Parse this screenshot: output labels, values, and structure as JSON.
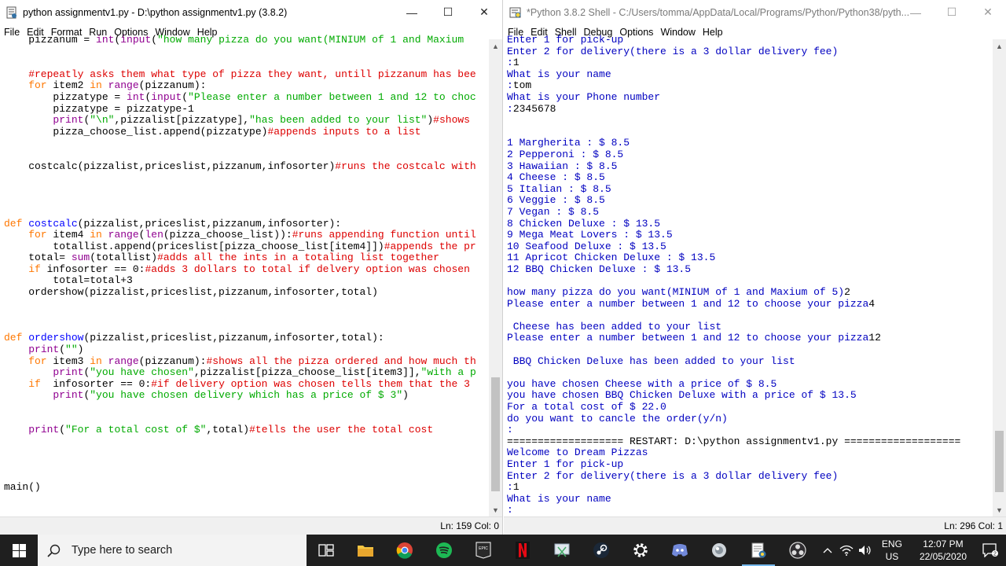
{
  "editor": {
    "title": "python assignmentv1.py - D:\\python assignmentv1.py (3.8.2)",
    "menu": [
      "File",
      "Edit",
      "Format",
      "Run",
      "Options",
      "Window",
      "Help"
    ],
    "status": "Ln: 159  Col: 0",
    "lines": [
      [
        [
          "",
          "    pizzanum = "
        ],
        [
          "bi",
          "int"
        ],
        [
          "",
          "("
        ],
        [
          "bi",
          "input"
        ],
        [
          "",
          "("
        ],
        [
          "st",
          "\"how many pizza do you want(MINIUM of 1 and Maxium"
        ]
      ],
      [],
      [],
      [
        [
          "cm",
          "    #repeatly asks them what type of pizza they want, untill pizzanum has bee"
        ]
      ],
      [
        [
          "kw",
          "    for"
        ],
        [
          "",
          " item2 "
        ],
        [
          "kw",
          "in"
        ],
        [
          "",
          " "
        ],
        [
          "bi",
          "range"
        ],
        [
          "",
          "(pizzanum):"
        ]
      ],
      [
        [
          "",
          "        pizzatype = "
        ],
        [
          "bi",
          "int"
        ],
        [
          "",
          "("
        ],
        [
          "bi",
          "input"
        ],
        [
          "",
          "("
        ],
        [
          "st",
          "\"Please enter a number between 1 and 12 to choc"
        ]
      ],
      [
        [
          "",
          "        pizzatype = pizzatype-1"
        ]
      ],
      [
        [
          "",
          "        "
        ],
        [
          "bi",
          "print"
        ],
        [
          "",
          "("
        ],
        [
          "st",
          "\"\\n\""
        ],
        [
          "",
          ",pizzalist[pizzatype],"
        ],
        [
          "st",
          "\"has been added to your list\""
        ],
        [
          "",
          ")"
        ],
        [
          "cm",
          "#shows"
        ]
      ],
      [
        [
          "",
          "        pizza_choose_list.append(pizzatype)"
        ],
        [
          "cm",
          "#appends inputs to a list"
        ]
      ],
      [],
      [],
      [
        [
          "",
          "    costcalc(pizzalist,priceslist,pizzanum,infosorter)"
        ],
        [
          "cm",
          "#runs the costcalc with"
        ]
      ],
      [],
      [],
      [],
      [],
      [
        [
          "kw",
          "def"
        ],
        [
          "",
          " "
        ],
        [
          "df",
          "costcalc"
        ],
        [
          "",
          "(pizzalist,priceslist,pizzanum,infosorter):"
        ]
      ],
      [
        [
          "kw",
          "    for"
        ],
        [
          "",
          " item4 "
        ],
        [
          "kw",
          "in"
        ],
        [
          "",
          " "
        ],
        [
          "bi",
          "range"
        ],
        [
          "",
          "("
        ],
        [
          "bi",
          "len"
        ],
        [
          "",
          "(pizza_choose_list)):"
        ],
        [
          "cm",
          "#runs appending function until"
        ]
      ],
      [
        [
          "",
          "        totallist.append(priceslist[pizza_choose_list[item4]])"
        ],
        [
          "cm",
          "#appends the pr"
        ]
      ],
      [
        [
          "",
          "    total= "
        ],
        [
          "bi",
          "sum"
        ],
        [
          "",
          "(totallist)"
        ],
        [
          "cm",
          "#adds all the ints in a totaling list together"
        ]
      ],
      [
        [
          "kw",
          "    if"
        ],
        [
          "",
          " infosorter == 0:"
        ],
        [
          "cm",
          "#adds 3 dollars to total if delvery option was chosen"
        ]
      ],
      [
        [
          "",
          "        total=total+3"
        ]
      ],
      [
        [
          "",
          "    ordershow(pizzalist,priceslist,pizzanum,infosorter,total)"
        ]
      ],
      [],
      [],
      [],
      [
        [
          "kw",
          "def"
        ],
        [
          "",
          " "
        ],
        [
          "df",
          "ordershow"
        ],
        [
          "",
          "(pizzalist,priceslist,pizzanum,infosorter,total):"
        ]
      ],
      [
        [
          "",
          "    "
        ],
        [
          "bi",
          "print"
        ],
        [
          "",
          "("
        ],
        [
          "st",
          "\"\""
        ],
        [
          "",
          ")"
        ]
      ],
      [
        [
          "kw",
          "    for"
        ],
        [
          "",
          " item3 "
        ],
        [
          "kw",
          "in"
        ],
        [
          "",
          " "
        ],
        [
          "bi",
          "range"
        ],
        [
          "",
          "(pizzanum):"
        ],
        [
          "cm",
          "#shows all the pizza ordered and how much th"
        ]
      ],
      [
        [
          "",
          "        "
        ],
        [
          "bi",
          "print"
        ],
        [
          "",
          "("
        ],
        [
          "st",
          "\"you have chosen\""
        ],
        [
          "",
          ",pizzalist[pizza_choose_list[item3]],"
        ],
        [
          "st",
          "\"with a p"
        ]
      ],
      [
        [
          "kw",
          "    if"
        ],
        [
          "",
          "  infosorter == 0:"
        ],
        [
          "cm",
          "#if delivery option was chosen tells them that the 3"
        ]
      ],
      [
        [
          "",
          "        "
        ],
        [
          "bi",
          "print"
        ],
        [
          "",
          "("
        ],
        [
          "st",
          "\"you have chosen delivery which has a price of $ 3\""
        ],
        [
          "",
          ")"
        ]
      ],
      [],
      [],
      [
        [
          "",
          "    "
        ],
        [
          "bi",
          "print"
        ],
        [
          "",
          "("
        ],
        [
          "st",
          "\"For a total cost of $\""
        ],
        [
          "",
          ",total)"
        ],
        [
          "cm",
          "#tells the user the total cost"
        ]
      ],
      [],
      [],
      [],
      [],
      [
        [
          "",
          "main()"
        ]
      ]
    ]
  },
  "shell": {
    "title": "*Python 3.8.2 Shell - C:/Users/tomma/AppData/Local/Programs/Python/Python38/pyth...",
    "menu": [
      "File",
      "Edit",
      "Shell",
      "Debug",
      "Options",
      "Window",
      "Help"
    ],
    "status": "Ln: 296  Col: 1",
    "lines": [
      [
        [
          "out",
          "Enter 1 for pick-up"
        ]
      ],
      [
        [
          "out",
          "Enter 2 for delivery(there is a 3 dollar delivery fee)"
        ]
      ],
      [
        [
          "out",
          ":"
        ],
        [
          "inp",
          "1"
        ]
      ],
      [
        [
          "out",
          "What is your name"
        ]
      ],
      [
        [
          "out",
          ":"
        ],
        [
          "inp",
          "tom"
        ]
      ],
      [
        [
          "out",
          "What is your Phone number"
        ]
      ],
      [
        [
          "out",
          ":"
        ],
        [
          "inp",
          "2345678"
        ]
      ],
      [],
      [],
      [
        [
          "out",
          "1 Margherita : $ 8.5"
        ]
      ],
      [
        [
          "out",
          "2 Pepperoni : $ 8.5"
        ]
      ],
      [
        [
          "out",
          "3 Hawaiian : $ 8.5"
        ]
      ],
      [
        [
          "out",
          "4 Cheese : $ 8.5"
        ]
      ],
      [
        [
          "out",
          "5 Italian : $ 8.5"
        ]
      ],
      [
        [
          "out",
          "6 Veggie : $ 8.5"
        ]
      ],
      [
        [
          "out",
          "7 Vegan : $ 8.5"
        ]
      ],
      [
        [
          "out",
          "8 Chicken Deluxe : $ 13.5"
        ]
      ],
      [
        [
          "out",
          "9 Mega Meat Lovers : $ 13.5"
        ]
      ],
      [
        [
          "out",
          "10 Seafood Deluxe : $ 13.5"
        ]
      ],
      [
        [
          "out",
          "11 Apricot Chicken Deluxe : $ 13.5"
        ]
      ],
      [
        [
          "out",
          "12 BBQ Chicken Deluxe : $ 13.5"
        ]
      ],
      [],
      [
        [
          "out",
          "how many pizza do you want(MINIUM of 1 and Maxium of 5)"
        ],
        [
          "inp",
          "2"
        ]
      ],
      [
        [
          "out",
          "Please enter a number between 1 and 12 to choose your pizza"
        ],
        [
          "inp",
          "4"
        ]
      ],
      [],
      [
        [
          "out",
          " Cheese has been added to your list"
        ]
      ],
      [
        [
          "out",
          "Please enter a number between 1 and 12 to choose your pizza"
        ],
        [
          "inp",
          "12"
        ]
      ],
      [],
      [
        [
          "out",
          " BBQ Chicken Deluxe has been added to your list"
        ]
      ],
      [],
      [
        [
          "out",
          "you have chosen Cheese with a price of $ 8.5"
        ]
      ],
      [
        [
          "out",
          "you have chosen BBQ Chicken Deluxe with a price of $ 13.5"
        ]
      ],
      [
        [
          "out",
          "For a total cost of $ 22.0"
        ]
      ],
      [
        [
          "out",
          "do you want to cancle the order(y/n)"
        ]
      ],
      [
        [
          "out",
          ":"
        ]
      ],
      [
        [
          "sep",
          "=================== RESTART: D:\\python assignmentv1.py ==================="
        ]
      ],
      [
        [
          "out",
          "Welcome to Dream Pizzas"
        ]
      ],
      [
        [
          "out",
          "Enter 1 for pick-up"
        ]
      ],
      [
        [
          "out",
          "Enter 2 for delivery(there is a 3 dollar delivery fee)"
        ]
      ],
      [
        [
          "out",
          ":"
        ],
        [
          "inp",
          "1"
        ]
      ],
      [
        [
          "out",
          "What is your name"
        ]
      ],
      [
        [
          "out",
          ":"
        ]
      ]
    ]
  },
  "window_controls": {
    "minimize": "—",
    "maximize": "☐",
    "close": "✕"
  },
  "taskbar": {
    "search_placeholder": "Type here to search",
    "apps": [
      "task-view",
      "file-explorer",
      "chrome",
      "spotify",
      "epic-games",
      "netflix",
      "snipping-tool",
      "steam",
      "settings",
      "discord",
      "mixed-reality",
      "python-idle",
      "obs"
    ],
    "active_app": "python-idle",
    "lang_top": "ENG",
    "lang_bottom": "US",
    "time": "12:07 PM",
    "date": "22/05/2020",
    "notification_count": "2"
  },
  "colors": {
    "keyword": "#ff7700",
    "builtin": "#900090",
    "string": "#00aa00",
    "comment": "#dd0000",
    "definition": "#0000ff",
    "shell_output": "#0000c0"
  }
}
